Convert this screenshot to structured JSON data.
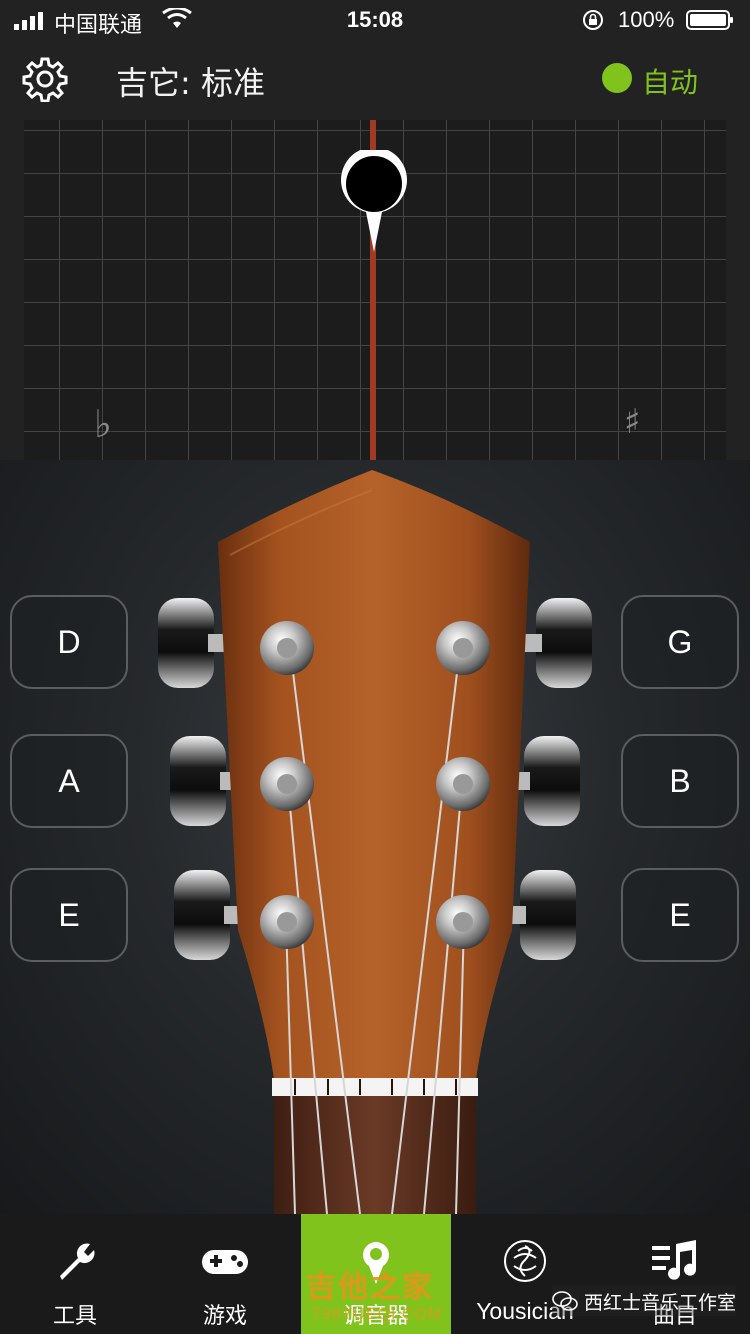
{
  "status_bar": {
    "carrier": "中国联通",
    "time": "15:08",
    "battery": "100%"
  },
  "header": {
    "title": "吉它: 标准",
    "auto_label": "自动",
    "auto_color": "#7fc31c"
  },
  "meter": {
    "flat_symbol": "♭",
    "sharp_symbol": "♯",
    "needle_color": "#a13a22"
  },
  "strings": {
    "left": [
      "D",
      "A",
      "E"
    ],
    "right": [
      "G",
      "B",
      "E"
    ]
  },
  "tabs": [
    {
      "label": "工具",
      "icon": "wrench-icon"
    },
    {
      "label": "游戏",
      "icon": "gamepad-icon"
    },
    {
      "label": "调音器",
      "icon": "tuner-icon",
      "active": true
    },
    {
      "label": "Yousician",
      "icon": "yousician-icon"
    },
    {
      "label": "曲目",
      "icon": "songs-icon"
    }
  ],
  "watermark": {
    "site_name": "吉他之家",
    "site_url": "798YUEQI.COM",
    "badge": "西红士音乐工作室"
  }
}
